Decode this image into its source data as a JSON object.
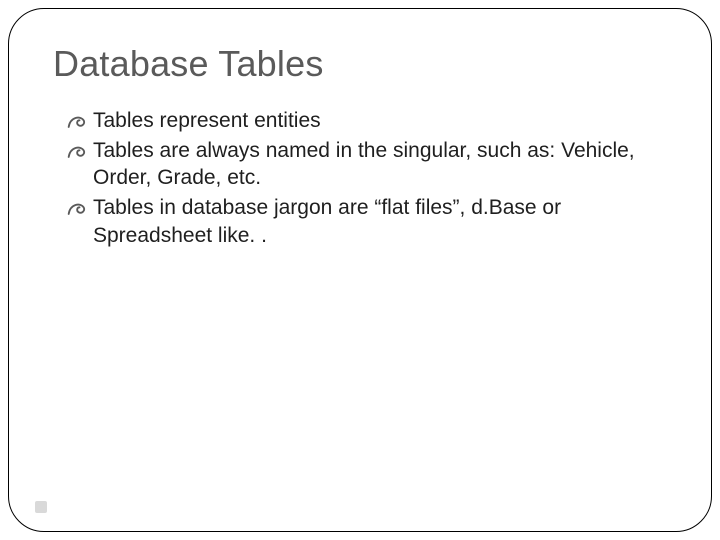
{
  "title": "Database Tables",
  "bullets": [
    "Tables represent entities",
    "Tables are always named in the singular, such as: Vehicle, Order, Grade, etc.",
    "Tables in database jargon are “flat files”, d.Base or Spreadsheet like. ."
  ]
}
